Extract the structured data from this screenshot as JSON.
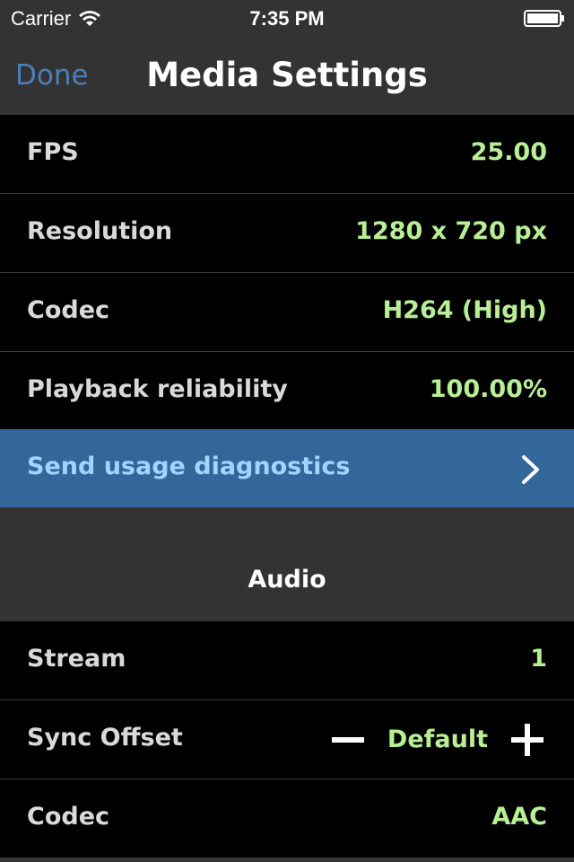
{
  "status_bar": {
    "carrier": "Carrier",
    "time": "7:35 PM",
    "wifi_icon": "wifi-icon",
    "battery_icon": "battery-icon"
  },
  "nav": {
    "done_label": "Done",
    "title": "Media Settings"
  },
  "video": {
    "rows": [
      {
        "label": "FPS",
        "value": "25.00"
      },
      {
        "label": "Resolution",
        "value": "1280 x 720 px"
      },
      {
        "label": "Codec",
        "value": "H264 (High)"
      },
      {
        "label": "Playback reliability",
        "value": "100.00%"
      }
    ],
    "action": {
      "label": "Send usage diagnostics",
      "icon": "chevron-right-icon"
    }
  },
  "audio": {
    "header": "Audio",
    "stream": {
      "label": "Stream",
      "value": "1"
    },
    "sync_offset": {
      "label": "Sync Offset",
      "value": "Default",
      "minus_icon": "minus-icon",
      "plus_icon": "plus-icon"
    },
    "codec": {
      "label": "Codec",
      "value": "AAC"
    }
  },
  "colors": {
    "background": "#333333",
    "row_background": "#000000",
    "label_text": "#d9d9d9",
    "value_text": "#b8ef96",
    "action_background": "#336699",
    "action_text": "#9fd6ff",
    "done_link": "#4d7fb7"
  }
}
